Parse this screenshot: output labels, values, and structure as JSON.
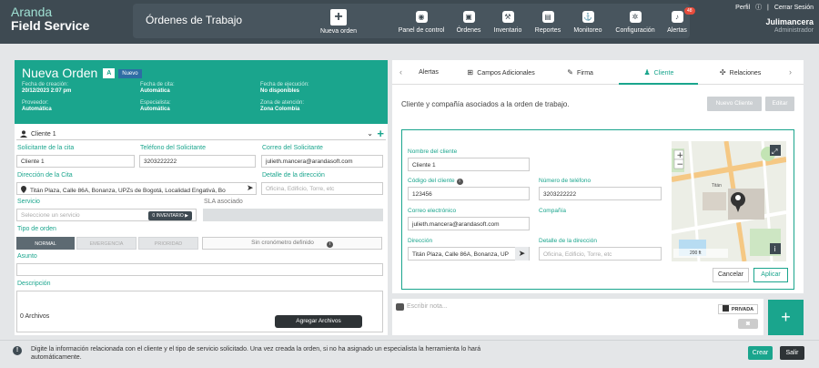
{
  "brand": {
    "line1": "Aranda",
    "line2": "Field Service"
  },
  "page_title": "Órdenes de Trabajo",
  "new_order_label": "Nueva orden",
  "nav": [
    {
      "label": "Panel de control",
      "icon": "dashboard-icon",
      "glyph": "◉"
    },
    {
      "label": "Órdenes",
      "icon": "orders-icon",
      "glyph": "▣"
    },
    {
      "label": "Inventario",
      "icon": "inventory-icon",
      "glyph": "⚒"
    },
    {
      "label": "Reportes",
      "icon": "reports-icon",
      "glyph": "▤"
    },
    {
      "label": "Monitoreo",
      "icon": "monitor-icon",
      "glyph": "⚓"
    },
    {
      "label": "Configuración",
      "icon": "gear-icon",
      "glyph": "✲"
    },
    {
      "label": "Alertas",
      "icon": "bell-icon",
      "glyph": "🔔",
      "badge": "48"
    }
  ],
  "user": {
    "perfil": "Perfil",
    "logout": "Cerrar Sesión",
    "name": "Julimancera",
    "role": "Administrador"
  },
  "order": {
    "title": "Nueva Orden",
    "badge_a": "A",
    "badge_new": "Nuevo",
    "fields": {
      "creation_k": "Fecha de creación:",
      "creation_v": "20/12/2023 2:07 pm",
      "appointment_k": "Fecha de cita:",
      "appointment_v": "Automática",
      "execution_k": "Fecha de ejecución:",
      "execution_v": "No disponibles",
      "provider_k": "Proveedor:",
      "provider_v": "Automática",
      "specialist_k": "Especialista:",
      "specialist_v": "Automática",
      "zone_k": "Zona de atención:",
      "zone_v": "Zona Colombia"
    }
  },
  "form": {
    "client_select": "Cliente 1",
    "requester_label": "Solicitante de la cita",
    "requester_value": "Cliente 1",
    "phone_label": "Teléfono del Solicitante",
    "phone_value": "3203222222",
    "email_label": "Correo del Solicitante",
    "email_value": "julieth.mancera@arandasoft.com",
    "address_label": "Dirección de la Cita",
    "address_value": "Titán Plaza, Calle 86A, Bonanza, UPZs de Bogotá, Localidad Engativá, Bo",
    "address_detail_label": "Detalle de la dirección",
    "address_detail_placeholder": "Oficina, Edificio, Torre, etc",
    "service_label": "Servicio",
    "service_placeholder": "Seleccione un servicio",
    "inventory_btn": "0 INVENTARIO ▶",
    "sla_label": "SLA asociado",
    "order_type_label": "Tipo de orden",
    "types": [
      "NORMAL",
      "EMERGENCIA",
      "PRIORIDAD"
    ],
    "chrono": "Sin cronómetro definido",
    "subject_label": "Asunto",
    "description_label": "Descripción",
    "files": "0 Archivos",
    "add_files": "Agregar Archivos"
  },
  "tabs": [
    {
      "label": "Alertas",
      "icon": "bell-outline-icon",
      "glyph": ""
    },
    {
      "label": "Campos Adicionales",
      "icon": "plus-square-icon",
      "glyph": "⊞"
    },
    {
      "label": "Firma",
      "icon": "pen-icon",
      "glyph": "✎"
    },
    {
      "label": "Cliente",
      "icon": "user-icon",
      "glyph": "👤"
    },
    {
      "label": "Relaciones",
      "icon": "relations-icon",
      "glyph": "✣"
    }
  ],
  "client_panel": {
    "intro": "Cliente y compañía asociados a la orden de trabajo.",
    "new_client": "Nuevo Cliente",
    "edit": "Editar",
    "name_label": "Nombre del cliente",
    "name_value": "Cliente 1",
    "code_label": "Código del cliente",
    "code_value": "123456",
    "phone_label": "Número de teléfono",
    "phone_value": "3203222222",
    "email_label": "Correo electrónico",
    "email_value": "julieth.mancera@arandasoft.com",
    "company_label": "Compañía",
    "address_label": "Dirección",
    "address_value": "Titán Plaza, Calle 86A, Bonanza, UP",
    "address_detail_label": "Detalle de la dirección",
    "address_detail_placeholder": "Oficina, Edificio, Torre, etc",
    "map_label": "Titán",
    "map_scale": "200 ft",
    "cancel": "Cancelar",
    "apply": "Aplicar"
  },
  "note": {
    "placeholder": "Escribir nota...",
    "private": "PRIVADA"
  },
  "footer": {
    "info": "Digite la información relacionada con el cliente y el tipo de servicio solicitado. Una vez creada la orden, si no ha asignado un especialista la herramienta lo hará automáticamente.",
    "create": "Crear",
    "exit": "Salir"
  },
  "colors": {
    "accent": "#1aa58d",
    "topbar": "#3e4a52",
    "dark": "#2e3336"
  }
}
